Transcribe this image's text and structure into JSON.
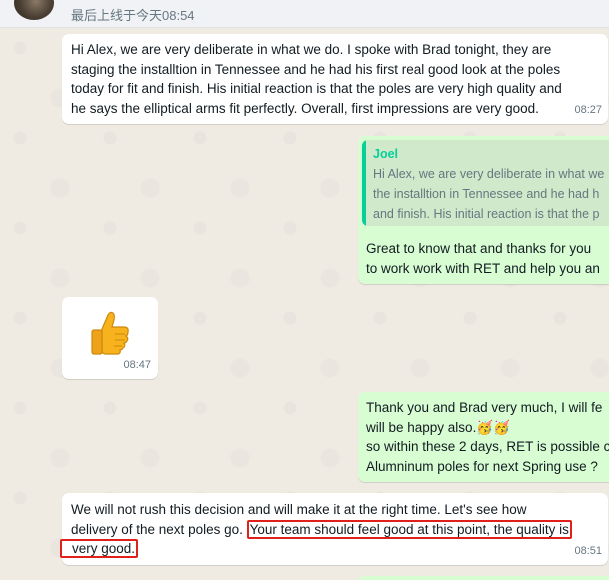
{
  "header": {
    "last_seen": "最后上线于今天08:54"
  },
  "messages": [
    {
      "direction": "incoming",
      "lines": [
        "Hi Alex, we are very deliberate in what we do. I spoke with Brad tonight, they are",
        "staging the installtion in Tennessee and he had his first real good look at the poles",
        "today for fit and finish. His initial reaction is that the poles are very high quality and",
        "he says the elliptical arms fit perfectly.  Overall, first impressions are very good."
      ],
      "time": "08:27"
    },
    {
      "direction": "outgoing",
      "quote": {
        "author": "Joel",
        "lines": [
          "Hi Alex, we are very deliberate in what we",
          "the installtion in Tennessee and he had h",
          "and finish. His initial reaction is that the p"
        ]
      },
      "lines": [
        "Great to know that and thanks for you",
        "to work work with RET and help you an"
      ]
    },
    {
      "direction": "incoming",
      "emoji": "thumbs-up",
      "time": "08:47"
    },
    {
      "direction": "outgoing",
      "lines": [
        "Thank you and Brad very much, I will fe",
        "will be happy also.",
        "so within these 2 days, RET is possible c",
        "Alumninum poles for next Spring use ?"
      ],
      "emoji_inline": "🥳🥳"
    },
    {
      "direction": "incoming",
      "line1": "We will not rush this decision and will make it at the right time. Let's see how",
      "line2_plain": "delivery of the next poles go. ",
      "line2_highlight": "Your team should feel good at this point, the quality is",
      "line3_highlight": "very good.",
      "time": "08:51"
    }
  ],
  "colors": {
    "incoming_bg": "#ffffff",
    "outgoing_bg": "#d9fdd3",
    "quote_accent": "#06cf9c",
    "highlight_box": "#e0201b"
  }
}
